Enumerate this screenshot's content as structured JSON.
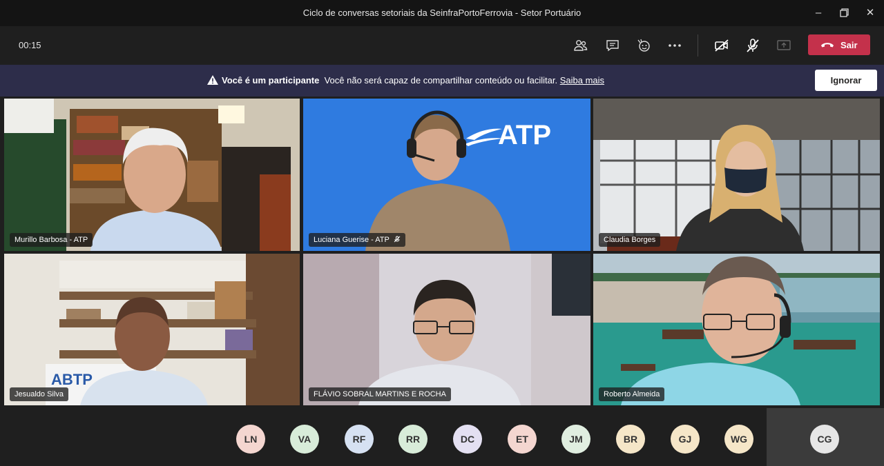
{
  "window": {
    "title": "Ciclo de conversas setoriais da SeinfraPortoFerrovia - Setor Portuário"
  },
  "toolbar": {
    "timer": "00:15",
    "leave_label": "Sair"
  },
  "banner": {
    "bold": "Você é um participante",
    "text": "Você não será capaz de compartilhar conteúdo ou facilitar.",
    "link": "Saiba mais",
    "ignore_label": "Ignorar"
  },
  "tiles": [
    {
      "name": "Murillo Barbosa - ATP"
    },
    {
      "name": "Luciana Guerise - ATP",
      "logo": "ATP"
    },
    {
      "name": "Claudia Borges"
    },
    {
      "name": "Jesualdo Silva",
      "logo": "ABTP"
    },
    {
      "name": "FLÁVIO SOBRAL MARTINS E ROCHA"
    },
    {
      "name": "Roberto Almeida"
    }
  ],
  "roster": [
    {
      "initials": "LN",
      "color": "#f4d6d0"
    },
    {
      "initials": "VA",
      "color": "#d8ecd9"
    },
    {
      "initials": "RF",
      "color": "#d6e1f2"
    },
    {
      "initials": "RR",
      "color": "#d8ecd9"
    },
    {
      "initials": "DC",
      "color": "#e4e0f2"
    },
    {
      "initials": "ET",
      "color": "#f4d6d0"
    },
    {
      "initials": "JM",
      "color": "#e0eee0"
    },
    {
      "initials": "BR",
      "color": "#f5e6c8"
    },
    {
      "initials": "GJ",
      "color": "#f5e6c8"
    },
    {
      "initials": "WG",
      "color": "#f5e6c8"
    },
    {
      "initials": "CG",
      "color": "#e6e6e6"
    }
  ],
  "colors": {
    "leave": "#c4314b",
    "banner": "#2d2d4a",
    "titlebar": "#141414"
  }
}
